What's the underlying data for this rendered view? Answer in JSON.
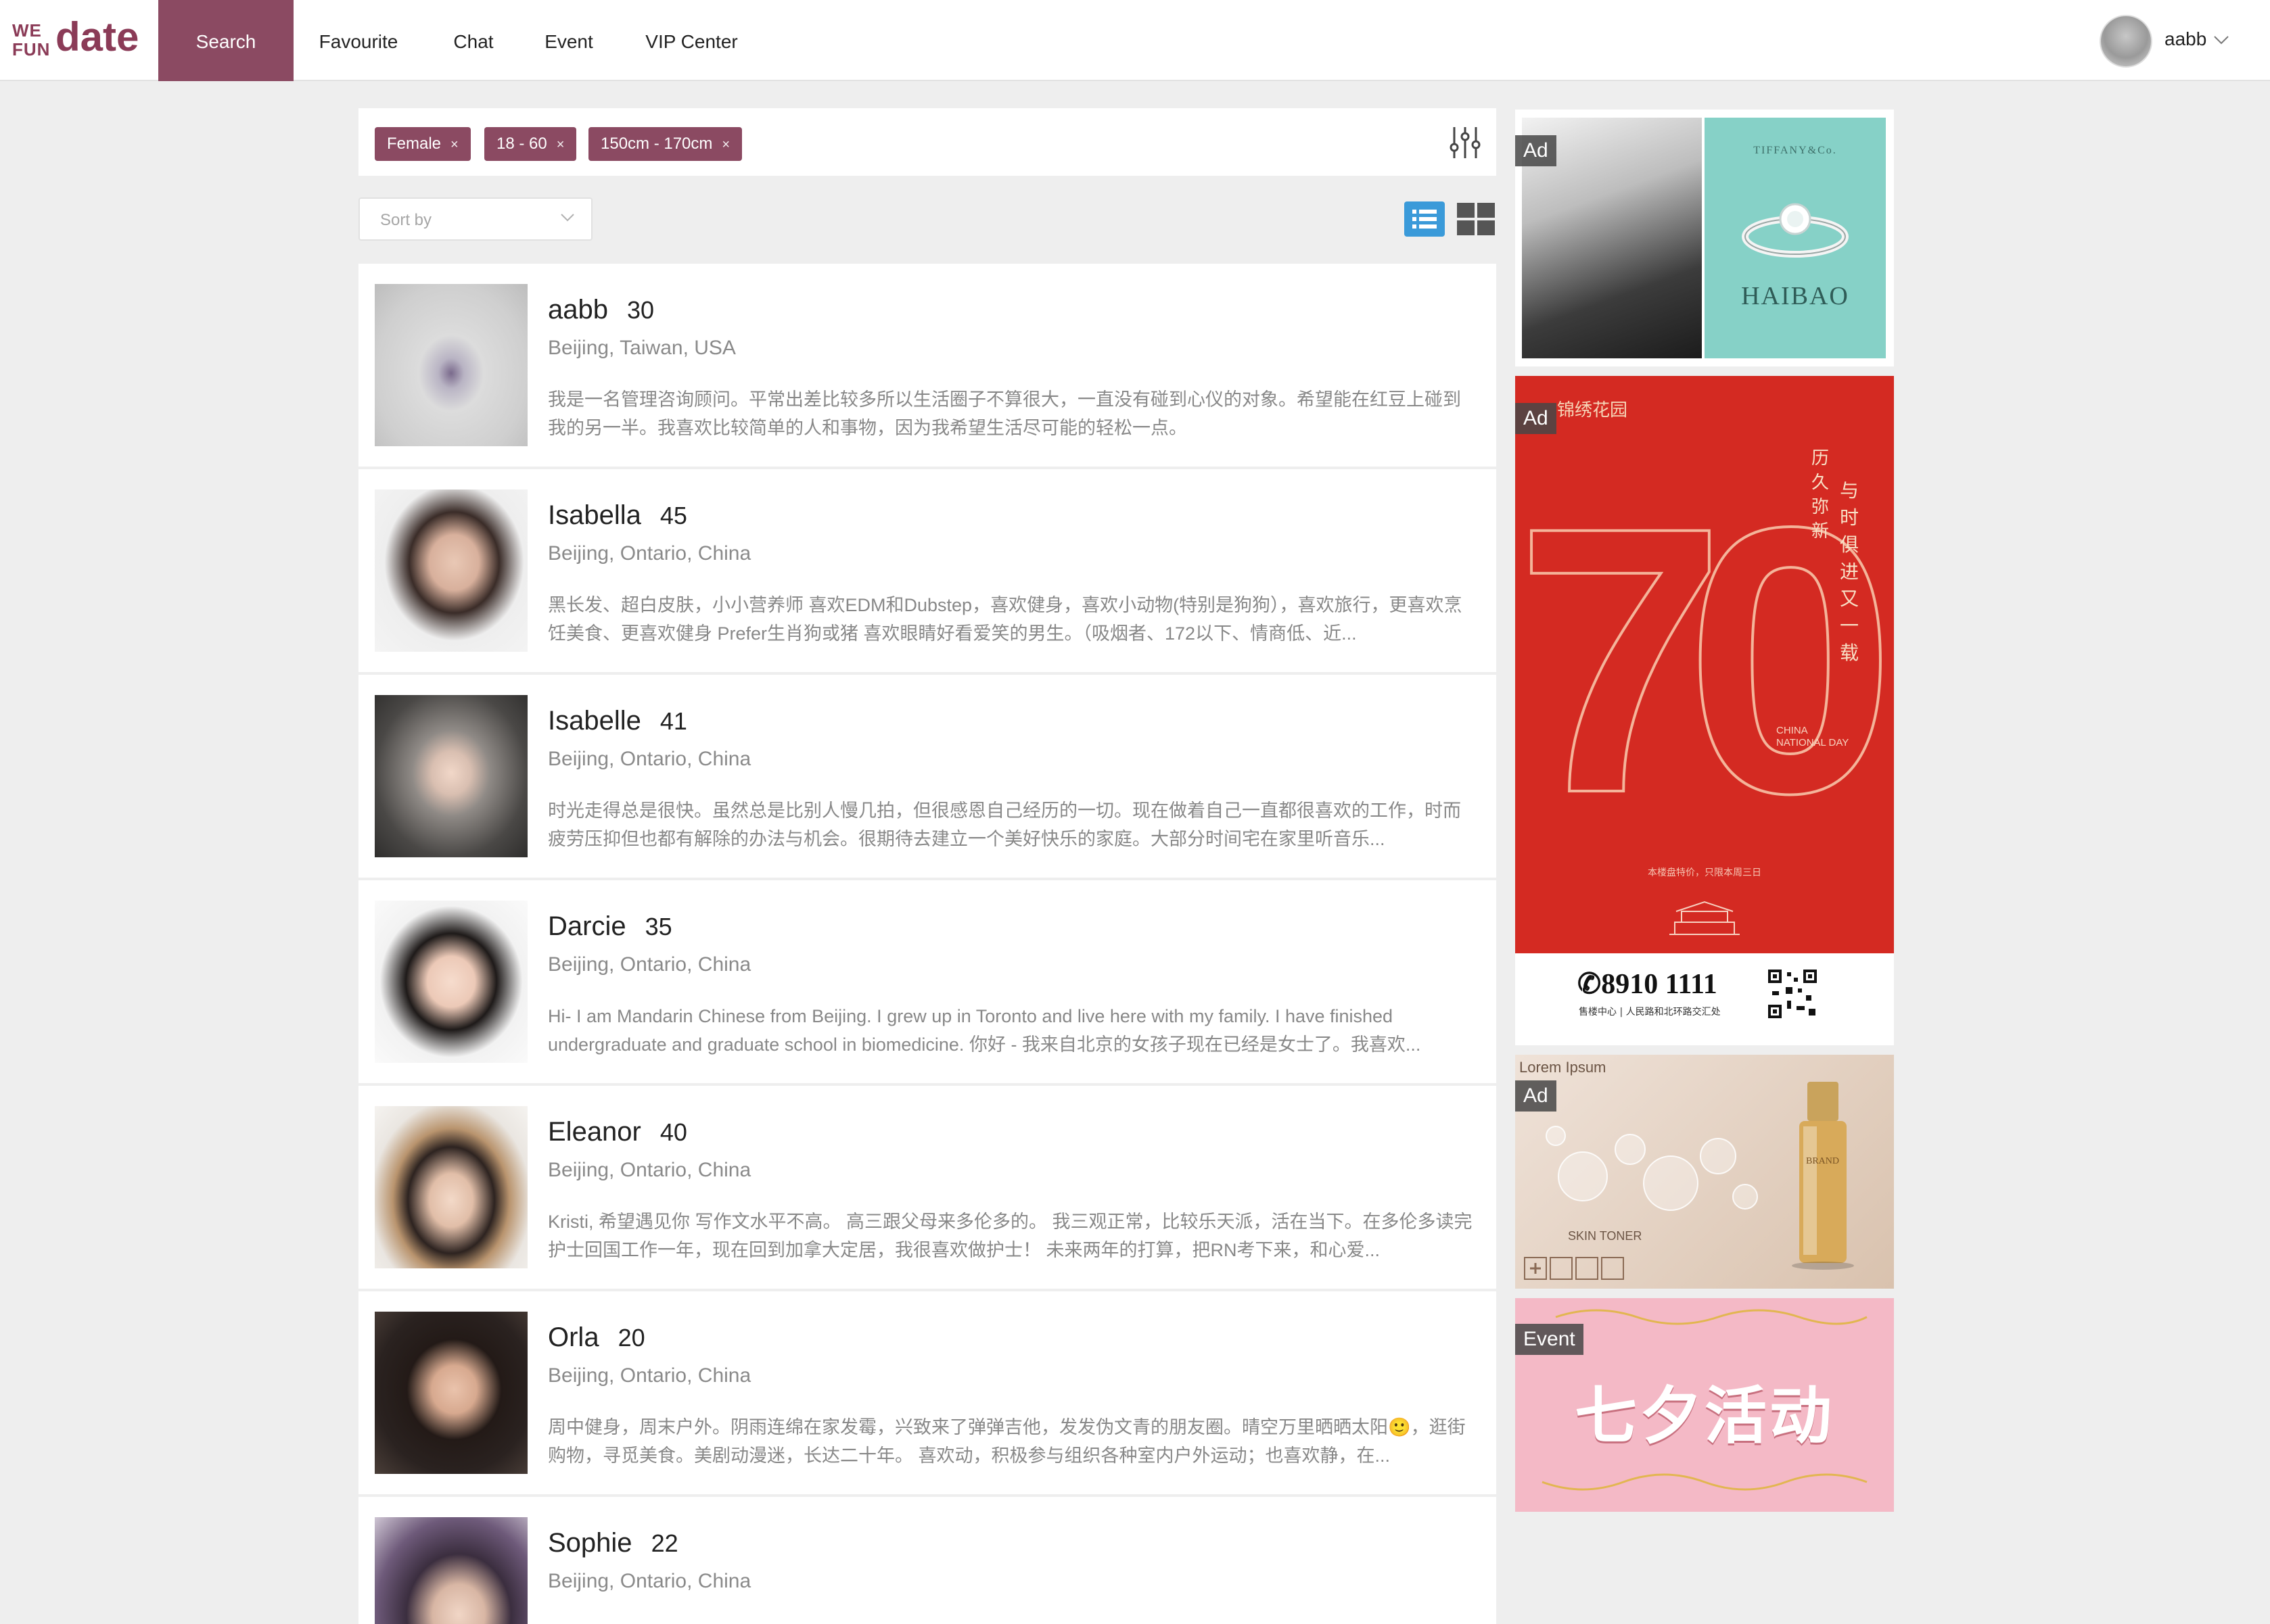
{
  "brand": {
    "we": "WE",
    "fun": "FUN",
    "date": "date",
    "color": "#8b3b57"
  },
  "nav": {
    "items": [
      {
        "label": "Search",
        "active": true
      },
      {
        "label": "Favourite",
        "active": false
      },
      {
        "label": "Chat",
        "active": false
      },
      {
        "label": "Event",
        "active": false
      },
      {
        "label": "VIP Center",
        "active": false
      }
    ],
    "active_color": "#8b4a62"
  },
  "user": {
    "name": "aabb"
  },
  "filters": {
    "chips": [
      {
        "label": "Female"
      },
      {
        "label": "18 - 60"
      },
      {
        "label": "150cm - 170cm"
      }
    ],
    "chip_remove_glyph": "×",
    "settings_icon": "sliders-icon"
  },
  "sort": {
    "placeholder": "Sort by"
  },
  "view": {
    "list_icon": "list-view-icon",
    "grid_icon": "grid-view-icon",
    "selected": "list",
    "accent": "#3a9ad9"
  },
  "profiles": [
    {
      "name": "aabb",
      "age": "30",
      "location": "Beijing, Taiwan, USA",
      "bio": "我是一名管理咨询顾问。平常出差比较多所以生活圈子不算很大，一直没有碰到心仪的对象。希望能在红豆上碰到我的另一半。我喜欢比较简单的人和事物，因为我希望生活尽可能的轻松一点。"
    },
    {
      "name": "Isabella",
      "age": "45",
      "location": "Beijing, Ontario, China",
      "bio": "黑长发、超白皮肤，小小营养师 喜欢EDM和Dubstep，喜欢健身，喜欢小动物(特别是狗狗），喜欢旅行，更喜欢烹饪美食、更喜欢健身 Prefer生肖狗或猪 喜欢眼睛好看爱笑的男生。（吸烟者、172以下、情商低、近..."
    },
    {
      "name": "Isabelle",
      "age": "41",
      "location": "Beijing, Ontario, China",
      "bio": "时光走得总是很快。虽然总是比别人慢几拍，但很感恩自己经历的一切。现在做着自己一直都很喜欢的工作，时而疲劳压抑但也都有解除的办法与机会。很期待去建立一个美好快乐的家庭。大部分时间宅在家里听音乐..."
    },
    {
      "name": "Darcie",
      "age": "35",
      "location": "Beijing, Ontario, China",
      "bio": "Hi- I am Mandarin Chinese from Beijing. I grew up in Toronto and live here with my family. I have finished undergraduate and graduate school in biomedicine. 你好 - 我来自北京的女孩子现在已经是女士了。我喜欢..."
    },
    {
      "name": "Eleanor",
      "age": "40",
      "location": "Beijing, Ontario, China",
      "bio": "Kristi, 希望遇见你 写作文水平不高。 高三跟父母来多伦多的。 我三观正常，比较乐天派，活在当下。在多伦多读完护士回国工作一年，现在回到加拿大定居，我很喜欢做护士！ 未来两年的打算，把RN考下来，和心爱..."
    },
    {
      "name": "Orla",
      "age": "20",
      "location": "Beijing, Ontario, China",
      "bio": "周中健身，周末户外。阴雨连绵在家发霉，兴致来了弹弹吉他，发发伪文青的朋友圈。晴空万里晒晒太阳🙂，逛街购物，寻觅美食。美剧动漫迷，长达二十年。 喜欢动，积极参与组织各种室内户外运动；也喜欢静，在..."
    },
    {
      "name": "Sophie",
      "age": "22",
      "location": "Beijing, Ontario, China",
      "bio": ""
    }
  ],
  "ads": [
    {
      "label": "Ad",
      "brand_small": "TIFFANY&Co.",
      "brand": "HAIBAO"
    },
    {
      "label": "Ad",
      "logo_text": "锦绣花园",
      "big_number": "70",
      "slogan_a": "与时俱进又一载",
      "slogan_b": "历久弥新",
      "national": "CHINA NATIONAL DAY",
      "phone": "✆8910 1111",
      "address": "售楼中心 | 人民路和北环路交汇处",
      "footnote": "本楼盘特价，只限本周三日"
    },
    {
      "label": "Ad",
      "lorem": "Lorem Ipsum",
      "product": "SKIN TONER",
      "bottle_text": "BRAND"
    },
    {
      "label": "Event",
      "title": "七夕活动"
    }
  ]
}
